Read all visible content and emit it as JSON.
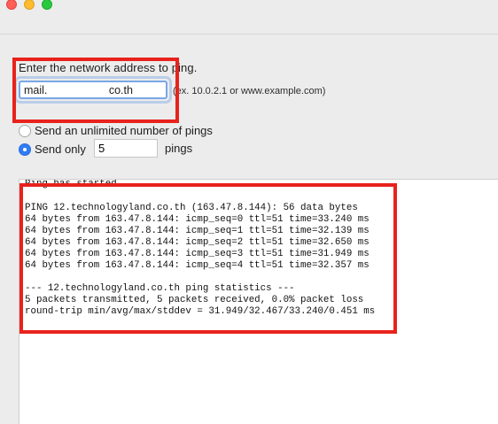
{
  "window": {
    "buttons": {
      "close": "close-button",
      "minimize": "minimize-button",
      "zoom": "zoom-button"
    }
  },
  "form": {
    "prompt": "Enter the network address to ping.",
    "address_value": "mail.                    co.th",
    "address_hint": "(ex. 10.0.2.1 or www.example.com)",
    "unlimited_label": "Send an unlimited number of pings",
    "send_only_label": "Send only",
    "count_value": "5",
    "pings_suffix": "pings",
    "selected_option": "send_only"
  },
  "output": {
    "lines": [
      "Ping has started…",
      "",
      "PING 12.technologyland.co.th (163.47.8.144): 56 data bytes",
      "64 bytes from 163.47.8.144: icmp_seq=0 ttl=51 time=33.240 ms",
      "64 bytes from 163.47.8.144: icmp_seq=1 ttl=51 time=32.139 ms",
      "64 bytes from 163.47.8.144: icmp_seq=2 ttl=51 time=32.650 ms",
      "64 bytes from 163.47.8.144: icmp_seq=3 ttl=51 time=31.949 ms",
      "64 bytes from 163.47.8.144: icmp_seq=4 ttl=51 time=32.357 ms",
      "",
      "--- 12.technologyland.co.th ping statistics ---",
      "5 packets transmitted, 5 packets received, 0.0% packet loss",
      "round-trip min/avg/max/stddev = 31.949/32.467/33.240/0.451 ms"
    ]
  },
  "annotation_color": "#e8221c",
  "accent_color": "#2f7cf6"
}
